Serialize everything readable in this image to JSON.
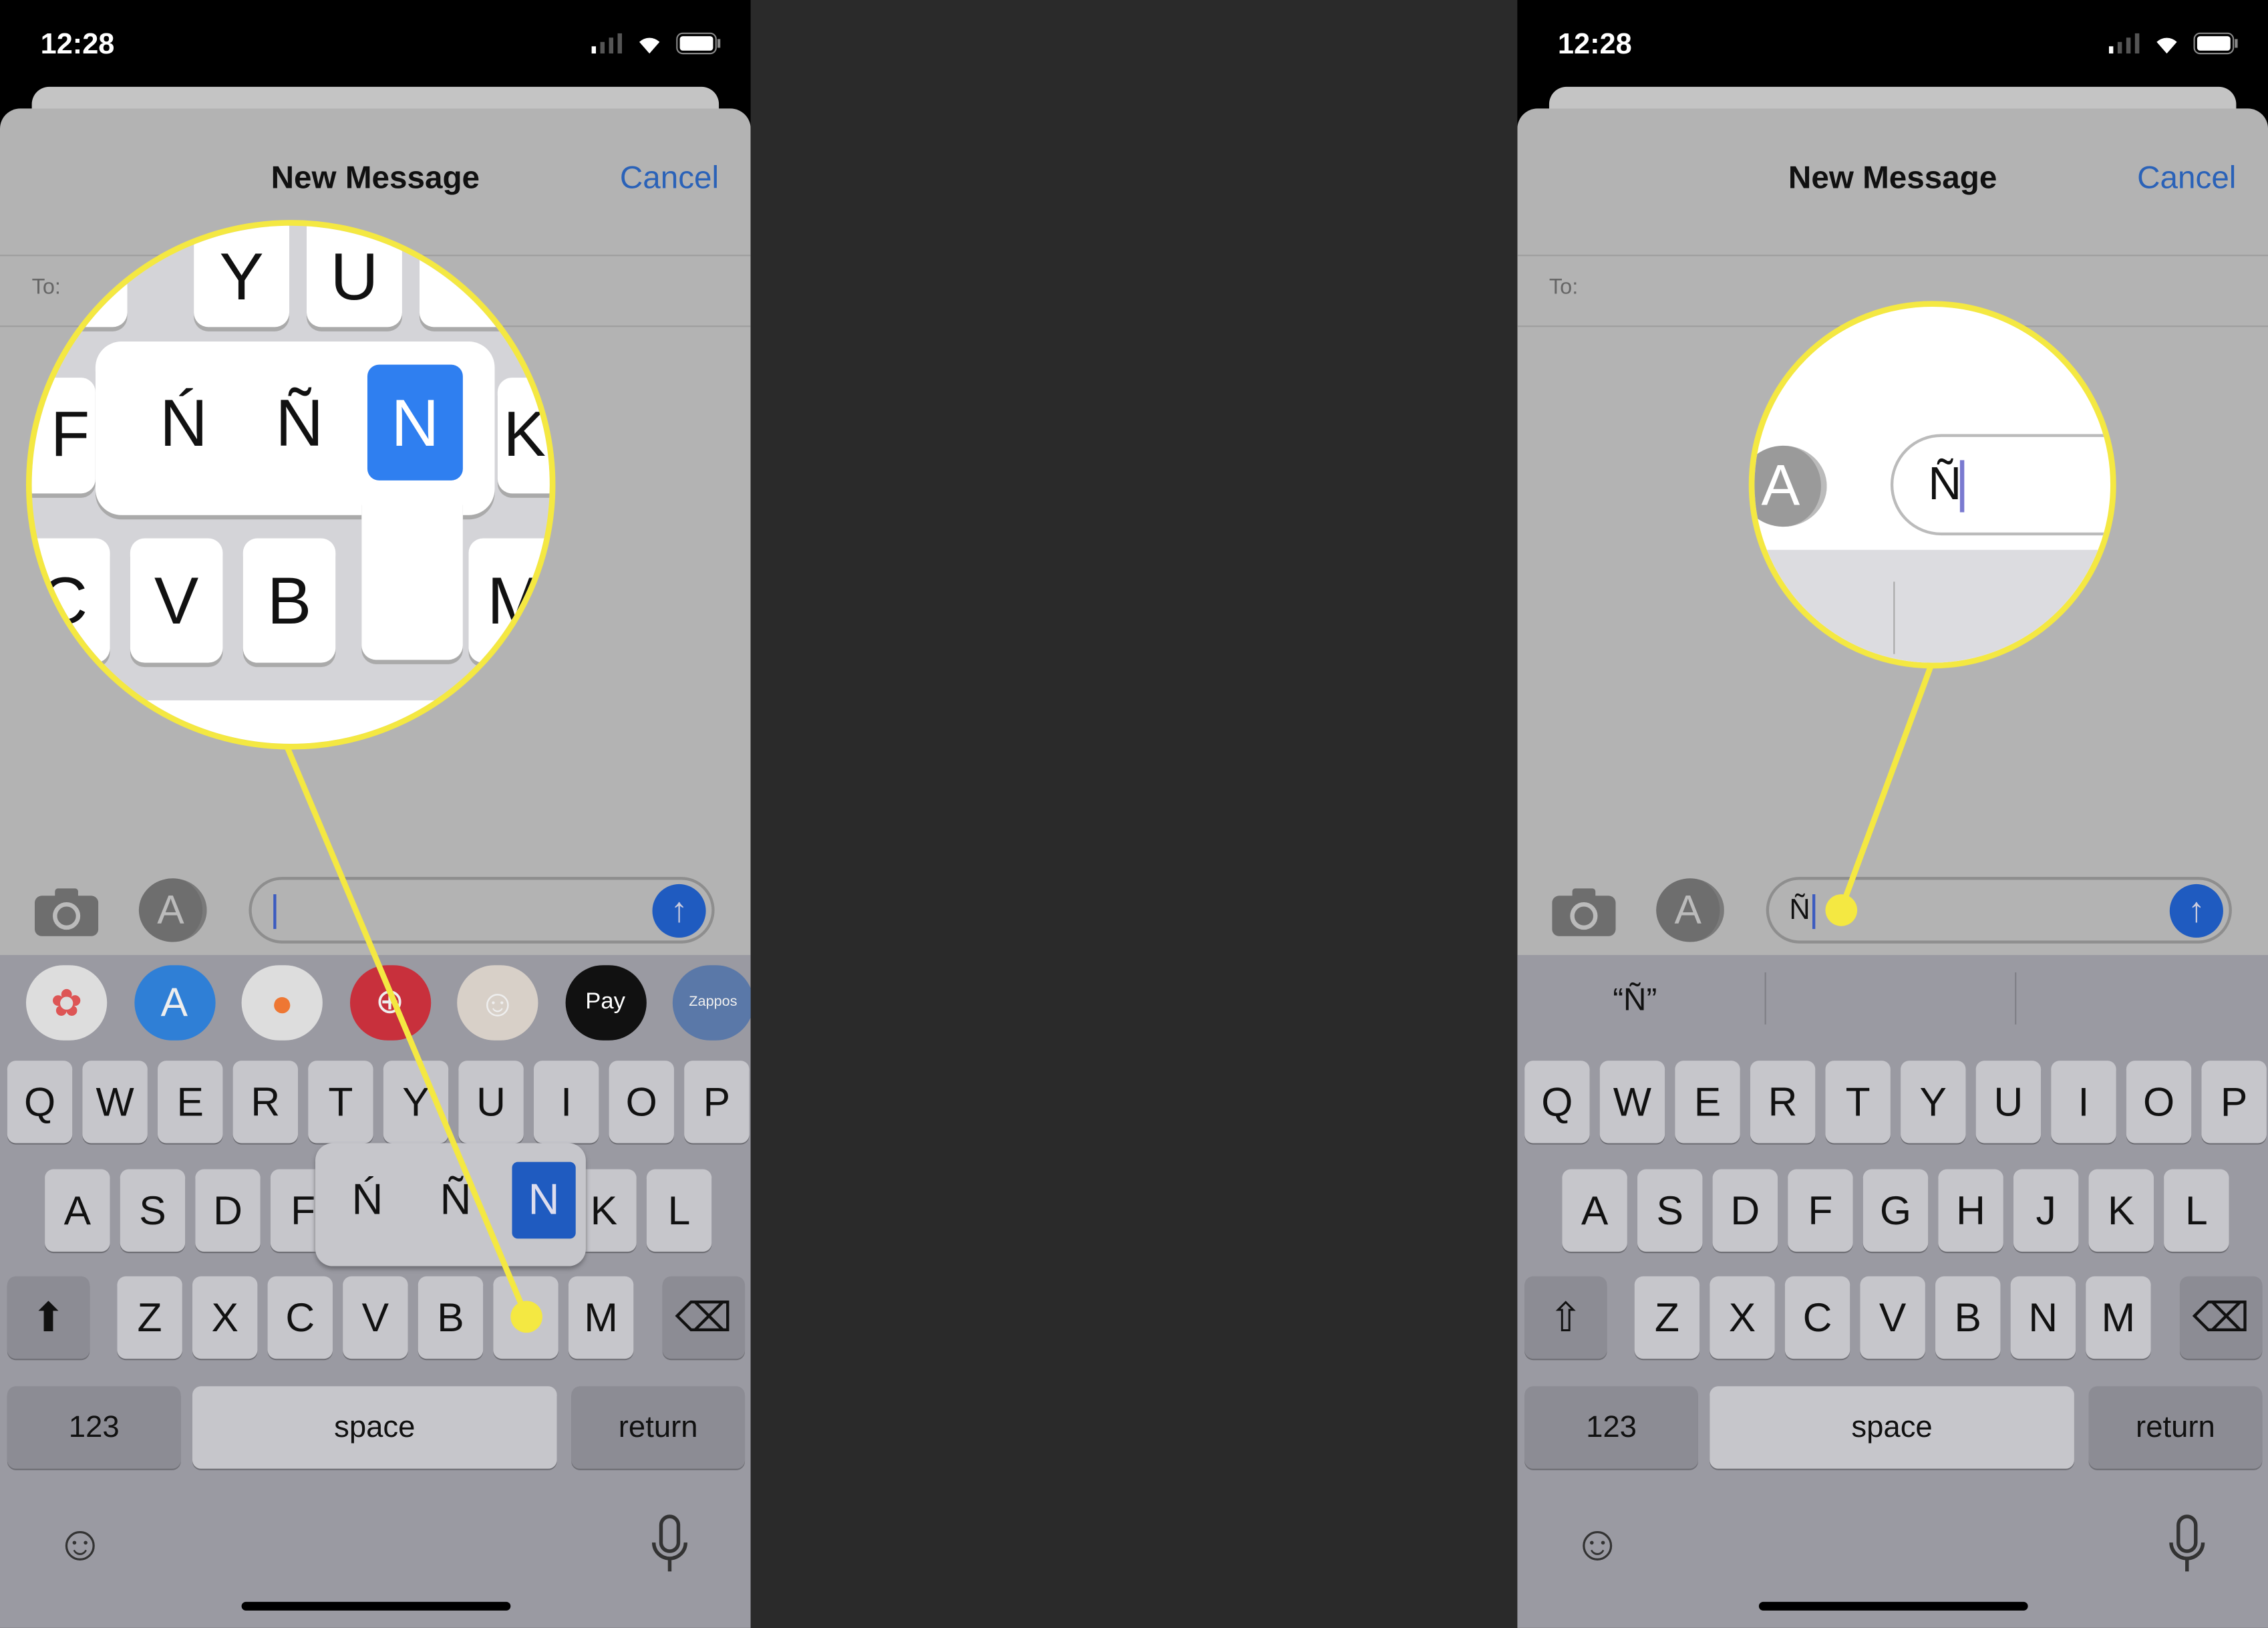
{
  "colors": {
    "accent": "#1f5bc0",
    "highlight": "#f4e842",
    "background": "#2a2a2a"
  },
  "left": {
    "status": {
      "time": "12:28"
    },
    "header": {
      "title": "New Message",
      "cancel": "Cancel"
    },
    "to_label": "To:",
    "input": {
      "value": "",
      "placeholder": ""
    },
    "app_strip": [
      {
        "name": "photos",
        "label": ""
      },
      {
        "name": "app-store",
        "label": ""
      },
      {
        "name": "apple-music-classic",
        "label": ""
      },
      {
        "name": "search-images",
        "label": ""
      },
      {
        "name": "memoji",
        "label": ""
      },
      {
        "name": "apple-pay",
        "label": "Pay"
      },
      {
        "name": "zappos",
        "label": "Zappos"
      }
    ],
    "accent_popup": [
      "Ń",
      "Ñ",
      "N"
    ],
    "accent_selected": "N",
    "zoom": {
      "top": [
        "Y",
        "U"
      ],
      "side_left": "F",
      "side_right": "K",
      "popup": [
        "Ń",
        "Ñ",
        "N"
      ],
      "bottom": [
        "C",
        "V",
        "B",
        "",
        "M"
      ]
    }
  },
  "right": {
    "status": {
      "time": "12:28"
    },
    "header": {
      "title": "New Message",
      "cancel": "Cancel"
    },
    "to_label": "To:",
    "input": {
      "value": "Ñ"
    },
    "predictions": [
      "“Ñ”",
      "",
      ""
    ],
    "zoom": {
      "typed": "Ñ"
    }
  },
  "keyboard": {
    "row1": [
      "Q",
      "W",
      "E",
      "R",
      "T",
      "Y",
      "U",
      "I",
      "O",
      "P"
    ],
    "row2": [
      "A",
      "S",
      "D",
      "F",
      "G",
      "H",
      "J",
      "K",
      "L"
    ],
    "row3": [
      "Z",
      "X",
      "C",
      "V",
      "B",
      "N",
      "M"
    ],
    "numbers": "123",
    "space": "space",
    "return": "return"
  }
}
